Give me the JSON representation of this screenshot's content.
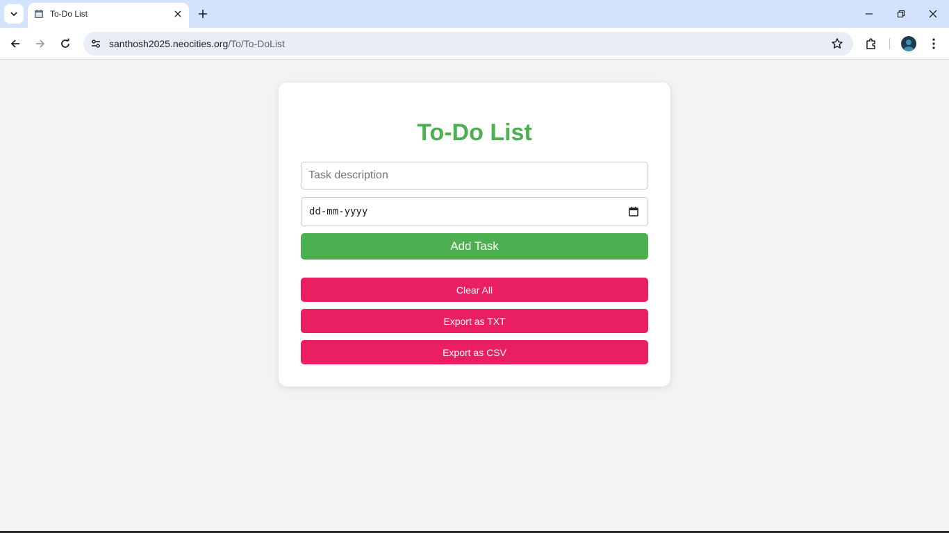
{
  "browser": {
    "tab_title": "To-Do List",
    "url_domain": "santhosh2025.neocities.org",
    "url_path": "/To/To-DoList",
    "icons": {
      "tab_search": "chevron-down-icon",
      "favicon": "calendar-favicon-icon",
      "tab_close": "close-icon",
      "new_tab": "plus-icon",
      "back": "arrow-left-icon",
      "forward": "arrow-right-icon",
      "reload": "reload-icon",
      "site_info": "tune-icon",
      "bookmark": "star-icon",
      "extensions": "puzzle-icon",
      "profile": "avatar",
      "menu": "kebab-menu-icon",
      "minimize": "minimize-icon",
      "restore": "restore-icon",
      "close_window": "close-icon"
    }
  },
  "page": {
    "title": "To-Do List",
    "task_input": {
      "placeholder": "Task description",
      "value": ""
    },
    "date_input": {
      "placeholder": "dd-mm-yyyy"
    },
    "buttons": {
      "add": "Add Task",
      "clear": "Clear All",
      "export_txt": "Export as TXT",
      "export_csv": "Export as CSV"
    }
  },
  "colors": {
    "accent_green": "#4caf50",
    "accent_pink": "#e91e63",
    "page_background": "#f3f3f3",
    "tabstrip": "#d3e3fd"
  }
}
